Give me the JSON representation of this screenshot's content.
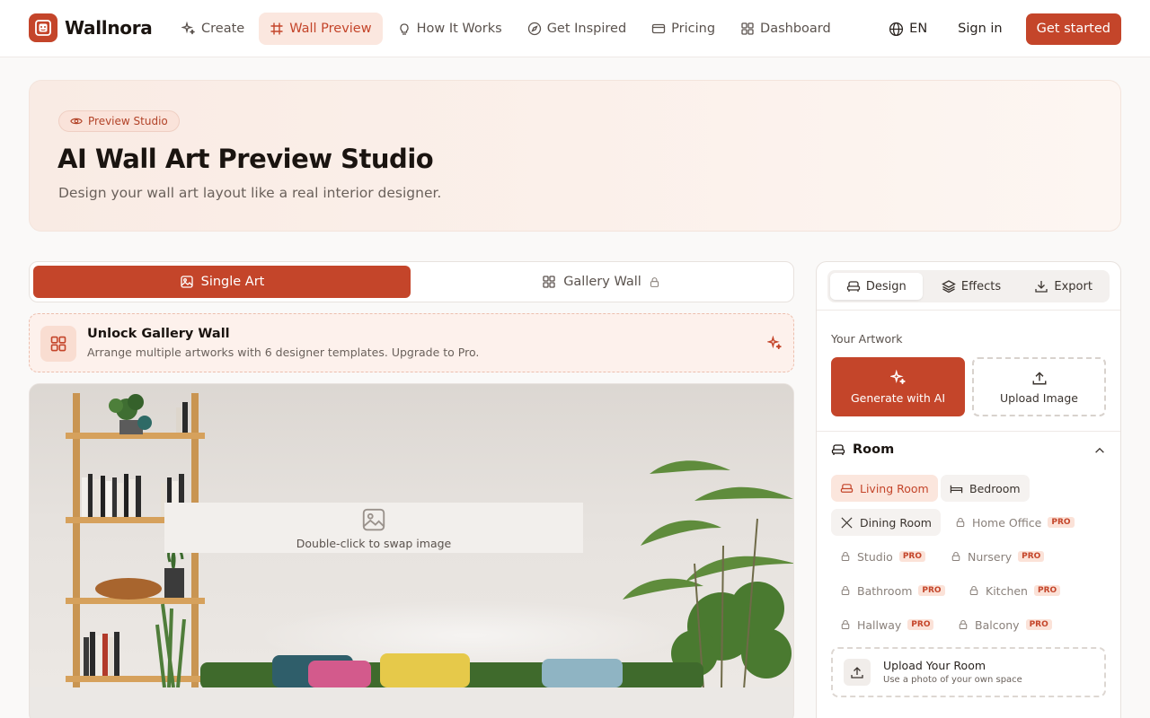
{
  "brand": {
    "name": "Wallnora",
    "accent": "#c4452a"
  },
  "nav": {
    "items": [
      {
        "label": "Create",
        "icon": "sparkles-icon"
      },
      {
        "label": "Wall Preview",
        "icon": "frame-icon",
        "active": true
      },
      {
        "label": "How It Works",
        "icon": "lightbulb-icon"
      },
      {
        "label": "Get Inspired",
        "icon": "compass-icon"
      },
      {
        "label": "Pricing",
        "icon": "credit-card-icon"
      },
      {
        "label": "Dashboard",
        "icon": "grid-icon"
      }
    ],
    "language": "EN",
    "sign_in": "Sign in",
    "get_started": "Get started"
  },
  "hero": {
    "badge": "Preview Studio",
    "title": "AI Wall Art Preview Studio",
    "subtitle": "Design your wall art layout like a real interior designer."
  },
  "mode_tabs": {
    "single": "Single Art",
    "gallery": "Gallery Wall"
  },
  "unlock": {
    "title": "Unlock Gallery Wall",
    "subtitle": "Arrange multiple artworks with 6 designer templates. Upgrade to Pro."
  },
  "stage": {
    "hint": "Double-click to swap image"
  },
  "panel": {
    "tabs": {
      "design": "Design",
      "effects": "Effects",
      "export": "Export"
    },
    "artwork_label": "Your Artwork",
    "generate": "Generate with AI",
    "upload": "Upload Image",
    "room_title": "Room",
    "pro_badge": "PRO",
    "rooms": [
      {
        "label": "Living Room",
        "state": "active"
      },
      {
        "label": "Bedroom",
        "state": "available"
      },
      {
        "label": "Dining Room",
        "state": "available"
      },
      {
        "label": "Home Office",
        "state": "locked"
      },
      {
        "label": "Studio",
        "state": "locked"
      },
      {
        "label": "Nursery",
        "state": "locked"
      },
      {
        "label": "Bathroom",
        "state": "locked"
      },
      {
        "label": "Kitchen",
        "state": "locked"
      },
      {
        "label": "Hallway",
        "state": "locked"
      },
      {
        "label": "Balcony",
        "state": "locked"
      }
    ],
    "upload_room": {
      "title": "Upload Your Room",
      "subtitle": "Use a photo of your own space"
    }
  }
}
